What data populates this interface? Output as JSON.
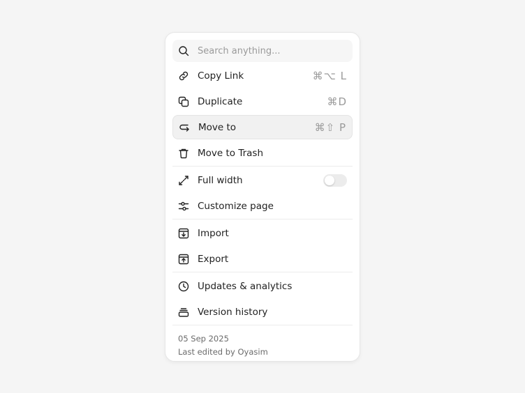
{
  "search": {
    "placeholder": "Search anything..."
  },
  "menu": {
    "items": [
      {
        "label": "Copy Link",
        "shortcut": "⌘⌥ L"
      },
      {
        "label": "Duplicate",
        "shortcut": "⌘D"
      },
      {
        "label": "Move to",
        "shortcut": "⌘⇧ P",
        "active": true
      },
      {
        "label": "Move to Trash"
      },
      {
        "label": "Full width",
        "toggle": false
      },
      {
        "label": "Customize page"
      },
      {
        "label": "Import"
      },
      {
        "label": "Export"
      },
      {
        "label": "Updates & analytics"
      },
      {
        "label": "Version history"
      }
    ]
  },
  "icons": [
    "search-icon",
    "link-icon",
    "copy-icon",
    "move-arrow-icon",
    "trash-icon",
    "expand-arrows-icon",
    "sliders-icon",
    "import-icon",
    "export-icon",
    "clock-icon",
    "layers-icon"
  ],
  "footer": {
    "date": "05 Sep 2025",
    "edited": "Last edited by Oyasim"
  },
  "colors": {
    "background": "#f5f5f5",
    "panel": "#ffffff",
    "active_row": "#f1f1f1",
    "muted_text": "#9a9a9a"
  }
}
